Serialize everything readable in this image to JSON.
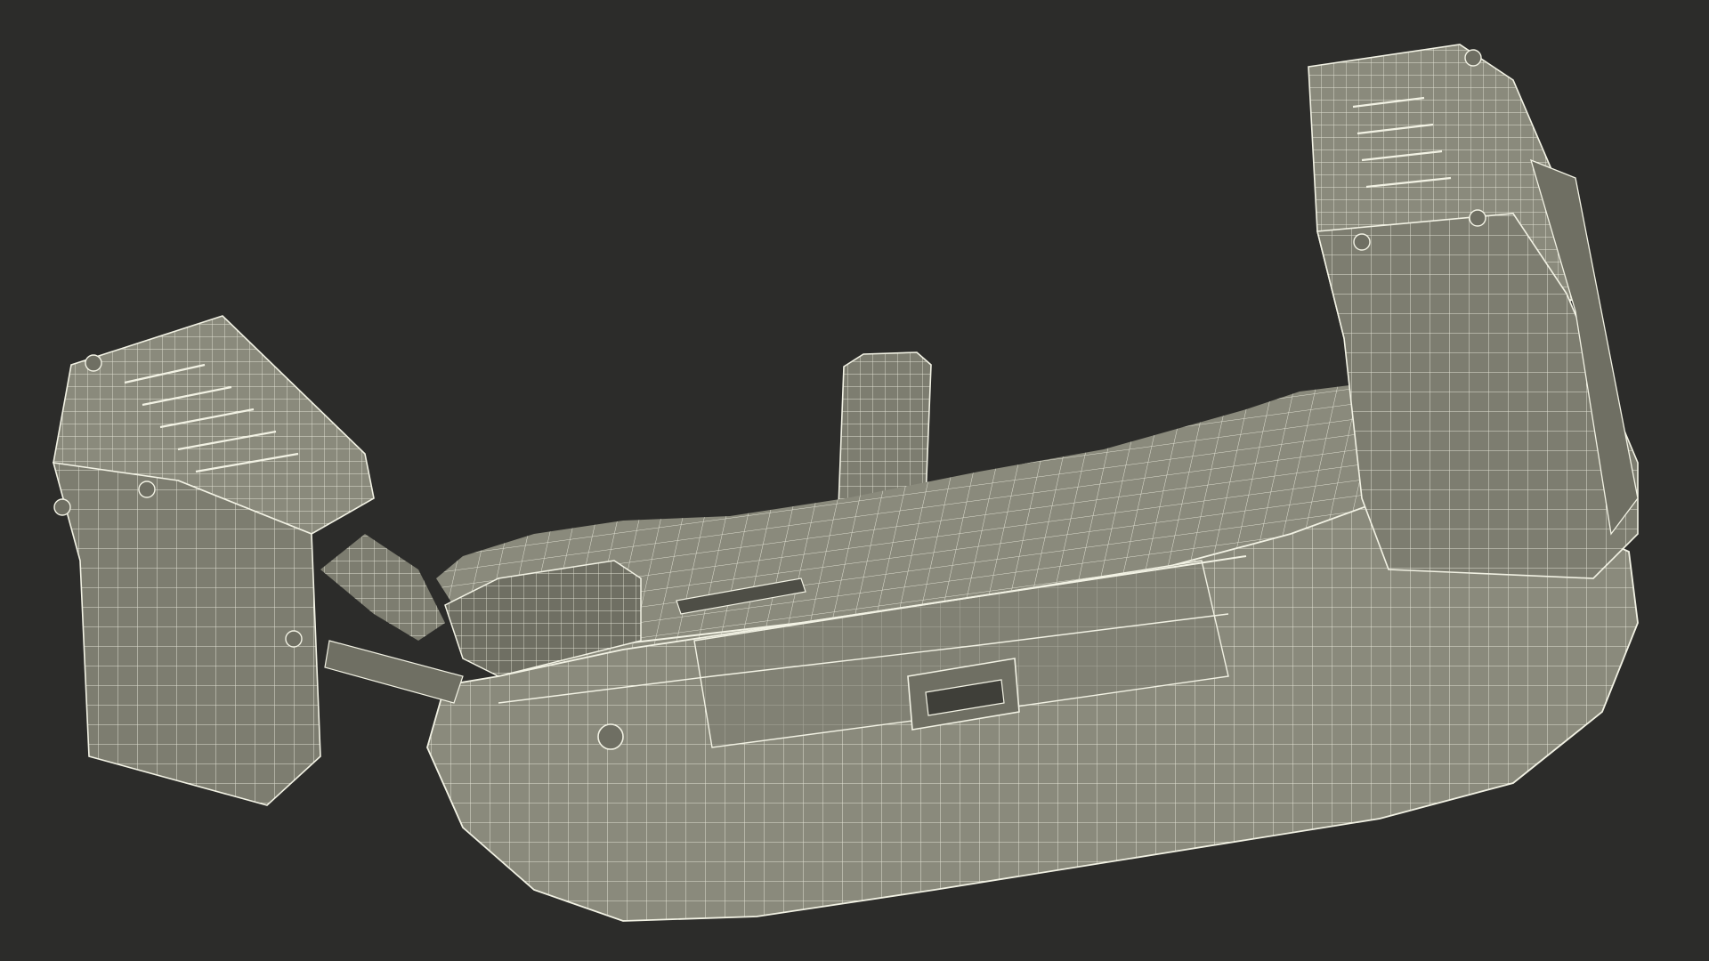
{
  "scene": {
    "background_color": "#2c2c2a",
    "surface_color": "#8a8a7c",
    "surface_shade_color": "#6f6f63",
    "surface_dark_color": "#5a5a50",
    "wire_color": "#f2f2e4"
  }
}
